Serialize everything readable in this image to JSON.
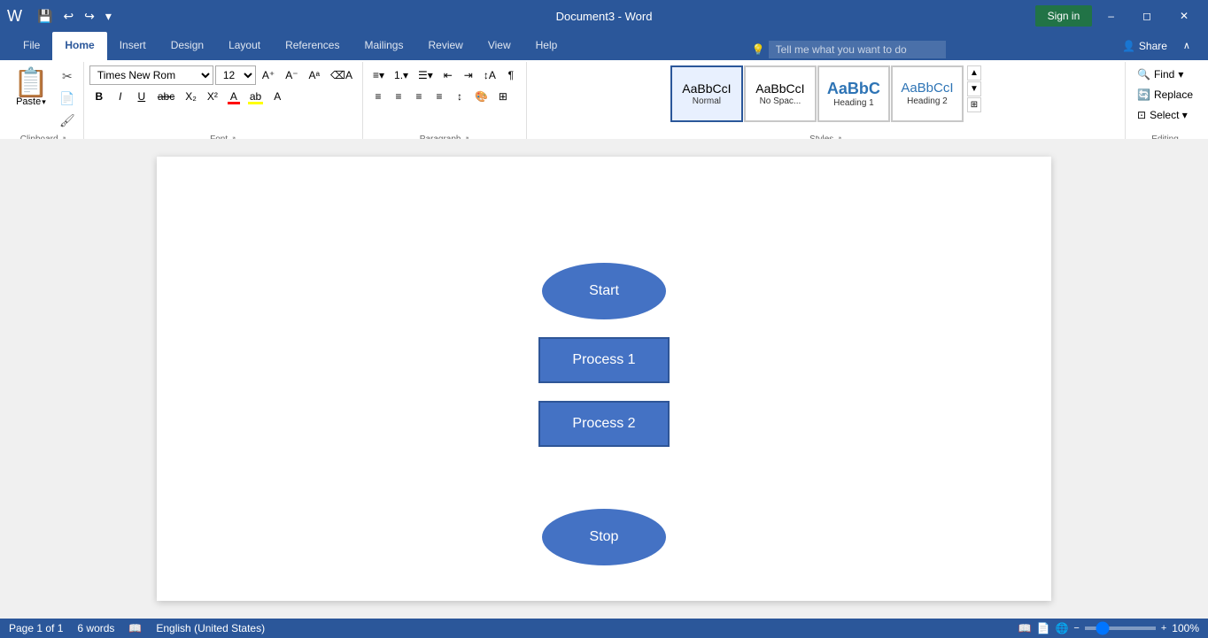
{
  "titlebar": {
    "doc_title": "Document3  -  Word",
    "sign_in": "Sign in",
    "quick_save": "💾",
    "quick_undo": "↩",
    "quick_redo": "↪",
    "more": "▾"
  },
  "ribbon": {
    "tabs": [
      "File",
      "Home",
      "Insert",
      "Design",
      "Layout",
      "References",
      "Mailings",
      "Review",
      "View",
      "Help"
    ],
    "active_tab": "Home",
    "tell_me_placeholder": "Tell me what you want to do",
    "groups": {
      "clipboard": "Clipboard",
      "font": "Font",
      "paragraph": "Paragraph",
      "styles": "Styles",
      "editing": "Editing"
    }
  },
  "font": {
    "family": "Times New Rom",
    "size": "12",
    "grow": "A",
    "shrink": "a"
  },
  "styles": {
    "items": [
      {
        "label": "Normal",
        "preview": "AaBbCcI",
        "active": true
      },
      {
        "label": "No Spac...",
        "preview": "AaBbCcI",
        "active": false
      },
      {
        "label": "Heading 1",
        "preview": "AaBbC",
        "active": false
      },
      {
        "label": "Heading 2",
        "preview": "AaBbCcI",
        "active": false
      }
    ]
  },
  "editing": {
    "find": "Find",
    "replace": "Replace",
    "select": "Select ▾"
  },
  "document": {
    "shapes": {
      "start": "Start",
      "process1": "Process 1",
      "process2": "Process 2",
      "stop": "Stop"
    }
  },
  "statusbar": {
    "page": "Page 1 of 1",
    "words": "6 words",
    "language": "English (United States)",
    "zoom": "100%"
  }
}
